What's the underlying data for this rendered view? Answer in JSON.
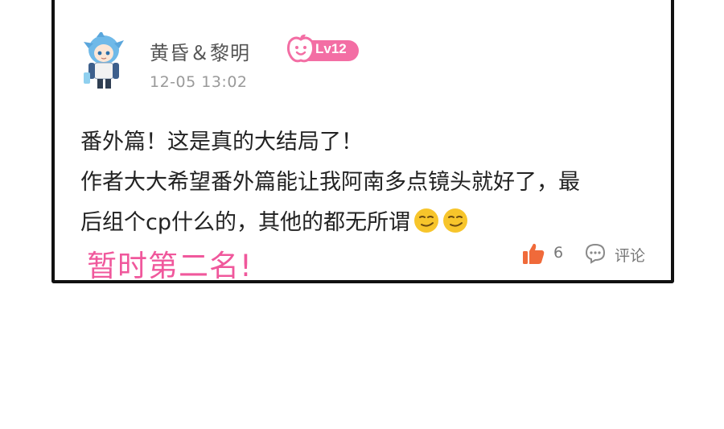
{
  "post": {
    "username": "黄昏＆黎明",
    "level": "Lv12",
    "timestamp": "12-05 13:02",
    "lines": [
      "番外篇！这是真的大结局了！",
      "作者大大希望番外篇能让我阿南多点镜头就好了，最",
      "后组个cp什么的，其他的都无所谓"
    ],
    "emoji": [
      "smirk-emoji",
      "smirk-emoji"
    ],
    "likes": "6",
    "comment_label": "评论"
  },
  "annotation": "暂时第二名!",
  "colors": {
    "accent_pink": "#f0589c",
    "badge_pink": "#f36ea4",
    "like_orange": "#f06a3a",
    "emoji_yellow": "#f7c52b",
    "frame": "#111111"
  },
  "icons": [
    "avatar",
    "apple-level-icon",
    "thumbs-up-icon",
    "comment-bubble-icon"
  ]
}
